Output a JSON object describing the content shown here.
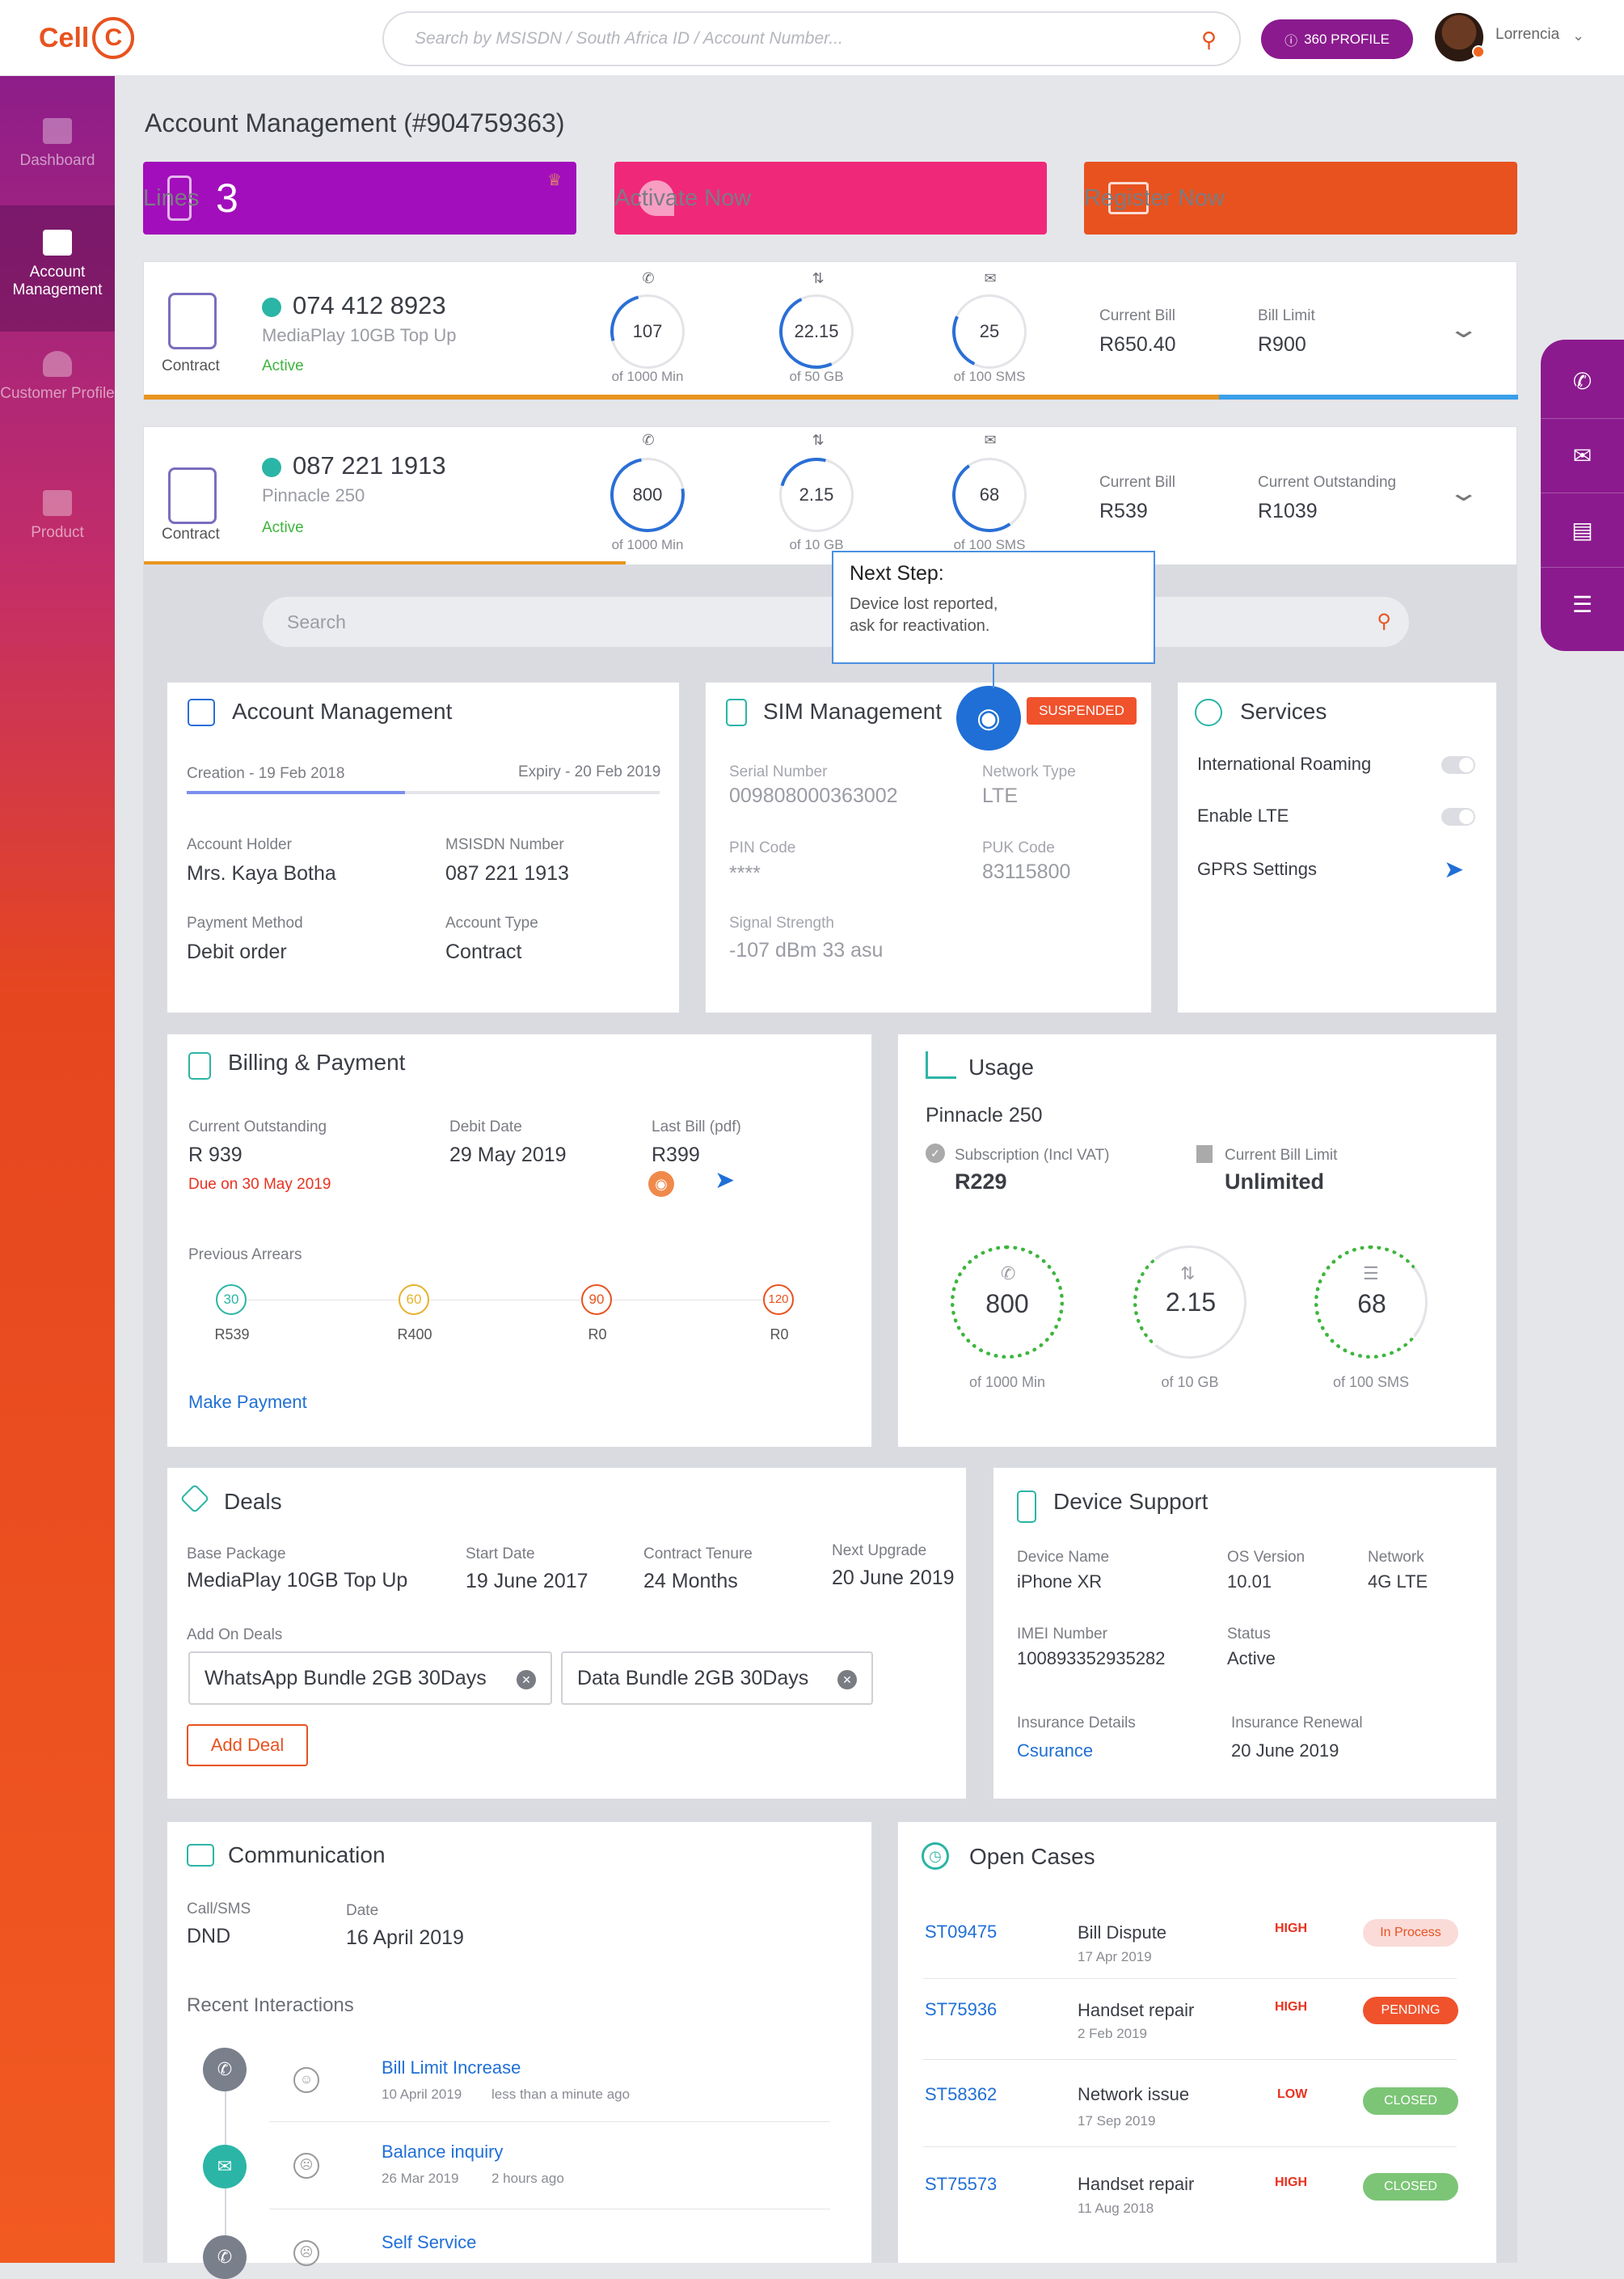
{
  "brand": {
    "logo_text": "Cell",
    "logo_c": "C"
  },
  "header": {
    "search_placeholder": "Search by MSISDN / South Africa ID / Account Number...",
    "profile_button": "360 PROFILE",
    "user_name": "Lorrencia"
  },
  "sidebar": {
    "items": [
      {
        "label": "Dashboard",
        "icon": "dashboard-icon",
        "active": false
      },
      {
        "label": "Account Management",
        "icon": "briefcase-icon",
        "active": true
      },
      {
        "label": "Customer Profile",
        "icon": "user-icon",
        "active": false
      },
      {
        "label": "Product",
        "icon": "product-icon",
        "active": false
      }
    ]
  },
  "page": {
    "title": "Account Management (#904759363)"
  },
  "kpis": {
    "lines_count": "3",
    "lines_label": "Lines",
    "activate_label": "Activate Now",
    "register_label": "Register Now"
  },
  "lines": [
    {
      "type": "Contract",
      "number": "074 412 8923",
      "plan": "MediaPlay 10GB Top Up",
      "status": "Active",
      "calls": "107",
      "calls_of": "of 1000 Min",
      "data": "22.15",
      "data_of": "of 50 GB",
      "sms": "25",
      "sms_of": "of 100 SMS",
      "label_a": "Current Bill",
      "value_a": "R650.40",
      "label_b": "Bill Limit",
      "value_b": "R900"
    },
    {
      "type": "Contract",
      "number": "087 221 1913",
      "plan": "Pinnacle 250",
      "status": "Active",
      "calls": "800",
      "calls_of": "of 1000 Min",
      "data": "2.15",
      "data_of": "of 10 GB",
      "sms": "68",
      "sms_of": "of 100 SMS",
      "label_a": "Current Bill",
      "value_a": "R539",
      "label_b": "Current Outstanding",
      "value_b": "R1039"
    }
  ],
  "inner_search": {
    "placeholder": "Search"
  },
  "tooltip": {
    "title": "Next Step:",
    "text_1": "Device lost reported,",
    "text_2": "ask for reactivation."
  },
  "account": {
    "title": "Account Management",
    "creation": "Creation - 19 Feb 2018",
    "expiry": "Expiry - 20 Feb 2019",
    "holder_label": "Account Holder",
    "holder": "Mrs. Kaya Botha",
    "msisdn_label": "MSISDN Number",
    "msisdn": "087 221 1913",
    "payment_label": "Payment Method",
    "payment": "Debit order",
    "type_label": "Account Type",
    "type": "Contract"
  },
  "sim": {
    "title": "SIM Management",
    "badge": "SUSPENDED",
    "serial_label": "Serial Number",
    "serial": "009808000363002",
    "network_label": "Network Type",
    "network": "LTE",
    "pin_label": "PIN Code",
    "pin": "****",
    "puk_label": "PUK Code",
    "puk": "83115800",
    "signal_label": "Signal Strength",
    "signal": "-107 dBm 33 asu"
  },
  "services": {
    "title": "Services",
    "roaming": "International Roaming",
    "lte": "Enable LTE",
    "gprs": "GPRS Settings"
  },
  "billing": {
    "title": "Billing & Payment",
    "outstanding_label": "Current Outstanding",
    "outstanding": "R 939",
    "due": "Due on 30 May 2019",
    "debit_label": "Debit Date",
    "debit": "29 May 2019",
    "last_label": "Last Bill (pdf)",
    "last": "R399",
    "arrears_label": "Previous Arrears",
    "arrears": [
      {
        "days": "30",
        "amount": "R539"
      },
      {
        "days": "60",
        "amount": "R400"
      },
      {
        "days": "90",
        "amount": "R0"
      },
      {
        "days": "120",
        "amount": "R0"
      }
    ],
    "pay_link": "Make Payment"
  },
  "usage": {
    "title": "Usage",
    "plan": "Pinnacle 250",
    "sub_label": "Subscription (Incl VAT)",
    "sub": "R229",
    "limit_label": "Current Bill Limit",
    "limit": "Unlimited",
    "calls": "800",
    "calls_of": "of 1000 Min",
    "data": "2.15",
    "data_of": "of 10 GB",
    "sms": "68",
    "sms_of": "of 100 SMS"
  },
  "deals": {
    "title": "Deals",
    "base_label": "Base Package",
    "base": "MediaPlay 10GB Top Up",
    "start_label": "Start Date",
    "start": "19 June 2017",
    "tenure_label": "Contract Tenure",
    "tenure": "24 Months",
    "upgrade_label": "Next Upgrade",
    "upgrade": "20 June 2019",
    "addon_label": "Add On Deals",
    "addons": [
      "WhatsApp Bundle 2GB 30Days",
      "Data Bundle 2GB 30Days"
    ],
    "add_button": "Add Deal"
  },
  "device": {
    "title": "Device Support",
    "name_label": "Device Name",
    "name": "iPhone XR",
    "os_label": "OS Version",
    "os": "10.01",
    "net_label": "Network",
    "net": "4G LTE",
    "imei_label": "IMEI Number",
    "imei": "100893352935282",
    "status_label": "Status",
    "status": "Active",
    "ins_label": "Insurance Details",
    "ins": "Csurance",
    "renew_label": "Insurance Renewal",
    "renew": "20 June 2019"
  },
  "communication": {
    "title": "Communication",
    "call_label": "Call/SMS",
    "call": "DND",
    "date_label": "Date",
    "date": "16 April 2019",
    "recent_label": "Recent Interactions",
    "items": [
      {
        "title": "Bill Limit Increase",
        "date": "10 April  2019",
        "ago": "less than a minute ago",
        "icon": "phone-icon",
        "mood": "happy"
      },
      {
        "title": "Balance inquiry",
        "date": "26 Mar 2019",
        "ago": "2 hours ago",
        "icon": "mail-icon",
        "mood": "sad"
      },
      {
        "title": "Self Service",
        "date": "",
        "ago": "",
        "icon": "phone-icon",
        "mood": "sad"
      }
    ]
  },
  "cases": {
    "title": "Open Cases",
    "items": [
      {
        "id": "ST09475",
        "title": "Bill Dispute",
        "date": "17 Apr 2019",
        "priority": "HIGH",
        "status": "In Process"
      },
      {
        "id": "ST75936",
        "title": "Handset repair",
        "date": "2 Feb 2019",
        "priority": "HIGH",
        "status": "PENDING"
      },
      {
        "id": "ST58362",
        "title": "Network issue",
        "date": "17 Sep 2019",
        "priority": "LOW",
        "status": "CLOSED"
      },
      {
        "id": "ST75573",
        "title": "Handset repair",
        "date": "11 Aug 2018",
        "priority": "HIGH",
        "status": "CLOSED"
      }
    ]
  },
  "right_rail": {
    "icons": [
      "phone-icon",
      "mail-icon",
      "receipt-icon",
      "chat-icon"
    ]
  },
  "colors": {
    "brand_orange": "#e8521f",
    "purple": "#8b1a8e",
    "magenta": "#a20ebb",
    "pink": "#f0287a",
    "link_blue": "#1f6fd6",
    "green": "#3db53d"
  }
}
